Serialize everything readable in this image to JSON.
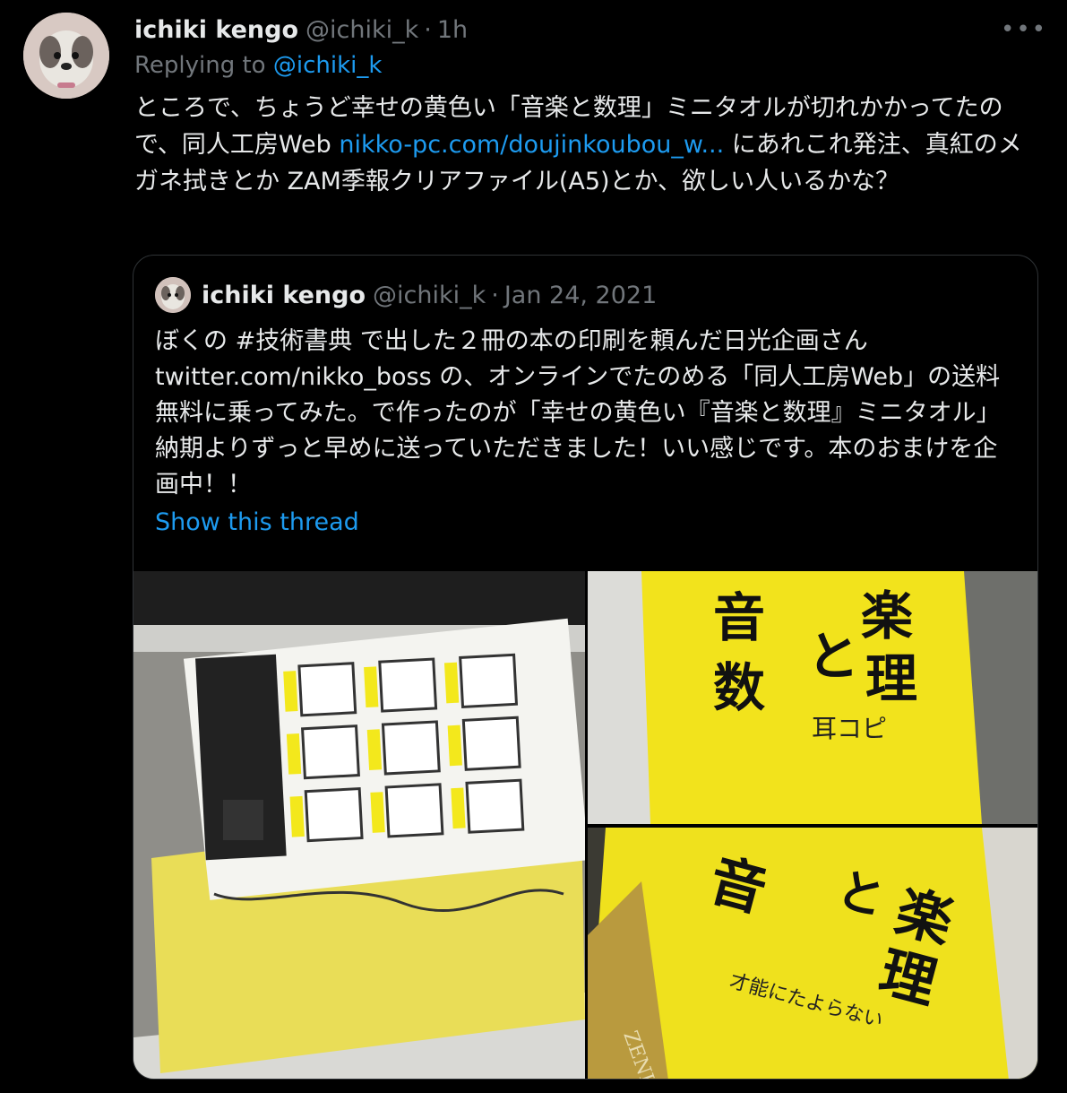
{
  "tweet": {
    "display_name": "ichiki kengo",
    "handle": "@ichiki_k",
    "separator": "·",
    "time": "1h",
    "more_label": "•••",
    "replying_to_label": "Replying to",
    "replying_to_handle": "@ichiki_k",
    "text_part1": "ところで、ちょうど幸せの黄色い「音楽と数理」ミニタオルが切れかかってたので、同人工房Web ",
    "link_text": "nikko-pc.com/doujinkoubou_w...",
    "text_part2": " にあれこれ発注、真紅のメガネ拭きとか ZAM季報クリアファイル(A5)とか、欲しい人いるかな？"
  },
  "quoted_tweet": {
    "display_name": "ichiki kengo",
    "handle": "@ichiki_k",
    "separator": "·",
    "date": "Jan 24, 2021",
    "text": "ぼくの #技術書典 で出した２冊の本の印刷を頼んだ日光企画さん twitter.com/nikko_boss の、オンラインでたのめる「同人工房Web」の送料無料に乗ってみた。で作ったのが「幸せの黄色い『音楽と数理』ミニタオル」納期よりずっと早めに送っていただきました！いい感じです。本のおまけを企画中！！",
    "show_thread_label": "Show this thread"
  },
  "media": {
    "photo2_title_chars": [
      "音",
      "楽",
      "と",
      "数",
      "理"
    ],
    "photo2_caption": "耳コピ",
    "photo3_chars": [
      "音",
      "楽",
      "と",
      "理"
    ],
    "photo3_sub": "才能にたよらない",
    "photo3_brand": "ZENKEI AI"
  },
  "colors": {
    "background": "#000000",
    "text": "#e7e9ea",
    "muted": "#71767b",
    "link": "#1d9bf0",
    "border": "#2f3336",
    "towel_yellow": "#f2e31c"
  }
}
